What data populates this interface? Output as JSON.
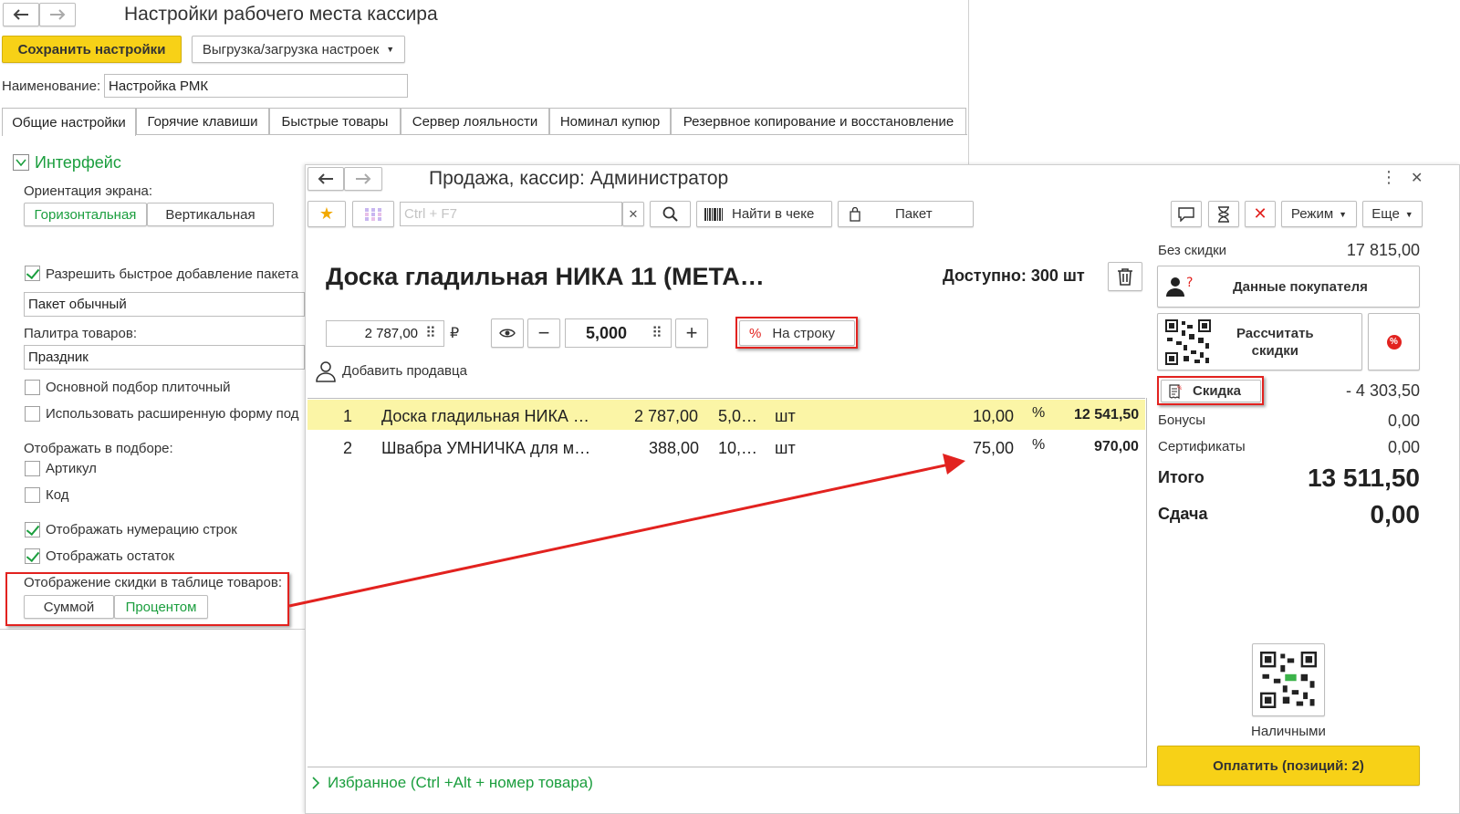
{
  "settings": {
    "title": "Настройки рабочего места кассира",
    "save_label": "Сохранить настройки",
    "export_label": "Выгрузка/загрузка настроек",
    "name_label": "Наименование:",
    "name_value": "Настройка РМК",
    "tabs": [
      "Общие настройки",
      "Горячие клавиши",
      "Быстрые товары",
      "Сервер лояльности",
      "Номинал купюр",
      "Резервное копирование и восстановление"
    ],
    "section_title": "Интерфейс",
    "orientation_label": "Ориентация экрана:",
    "orientation_options": [
      "Горизонтальная",
      "Вертикальная"
    ],
    "fast_package_label": "Разрешить быстрое добавление пакета",
    "package_value": "Пакет обычный",
    "palette_label": "Палитра товаров:",
    "palette_value": "Праздник",
    "tile_picker_label": "Основной подбор плиточный",
    "extended_form_label": "Использовать расширенную форму под",
    "show_in_picker_label": "Отображать в подборе:",
    "article_label": "Артикул",
    "code_label": "Код",
    "row_numbering_label": "Отображать нумерацию строк",
    "stock_label": "Отображать остаток",
    "discount_display_label": "Отображение скидки в таблице товаров:",
    "discount_display_options": [
      "Суммой",
      "Процентом"
    ]
  },
  "sale": {
    "title": "Продажа, кассир: Администратор",
    "search_placeholder": "Ctrl + F7",
    "find_label": "Найти в чеке",
    "package_label": "Пакет",
    "mode_label": "Режим",
    "more_label": "Еще",
    "product_title": "Доска гладильная  НИКА 11 (МЕТА…",
    "available": "Доступно: 300 шт",
    "price": "2 787,00",
    "currency": "₽",
    "quantity": "5,000",
    "to_line_label": "На строку",
    "add_seller_label": "Добавить продавца",
    "rows": [
      {
        "n": "1",
        "name": "Доска гладильная  НИКА …",
        "price": "2 787,00",
        "qty": "5,0…",
        "unit": "шт",
        "discount": "10,00",
        "pct": "%",
        "sum": "12 541,50"
      },
      {
        "n": "2",
        "name": "Швабра УМНИЧКА для м…",
        "price": "388,00",
        "qty": "10,…",
        "unit": "шт",
        "discount": "75,00",
        "pct": "%",
        "sum": "970,00"
      }
    ],
    "favorites_label": "Избранное (Ctrl +Alt + номер товара)"
  },
  "totals": {
    "without_discount_label": "Без скидки",
    "without_discount_value": "17 815,00",
    "customer_data_label": "Данные покупателя",
    "calc_discount_label_1": "Рассчитать",
    "calc_discount_label_2": "скидки",
    "discount_label": "Скидка",
    "discount_value": "- 4 303,50",
    "bonuses_label": "Бонусы",
    "bonuses_value": "0,00",
    "certificates_label": "Сертификаты",
    "certificates_value": "0,00",
    "total_label": "Итого",
    "total_value": "13 511,50",
    "change_label": "Сдача",
    "change_value": "0,00",
    "cash_label": "Наличными",
    "pay_label": "Оплатить (позиций: 2)"
  },
  "colors": {
    "accent_yellow": "#f7d117",
    "green_text": "#1b9e3e",
    "highlight_red": "#e2221f",
    "row_highlight": "#fbf5a6"
  }
}
